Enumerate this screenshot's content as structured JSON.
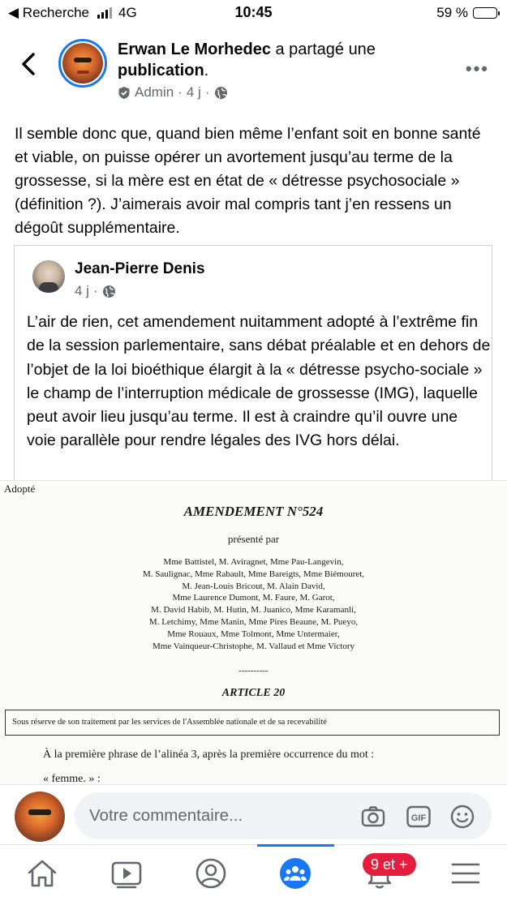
{
  "status_bar": {
    "back_app": "◀ Recherche",
    "network": "4G",
    "time": "10:45",
    "battery": "59 %",
    "battery_level": 0.59
  },
  "header": {
    "author_name": "Erwan Le Morhedec",
    "action_text": " a partagé une ",
    "action_link": "publication",
    "action_end": ".",
    "role": "Admin",
    "time": "4 j"
  },
  "post": {
    "text": "Il semble donc que, quand bien même l’enfant soit en bonne santé et viable, on puisse opérer un avortement jusqu’au terme de la grossesse, si la mère est en état de « détresse psychosociale » (définition ?). J’aimerais avoir mal compris tant j’en ressens un dégoût supplémentaire."
  },
  "shared": {
    "author": "Jean-Pierre Denis",
    "time": "4 j",
    "text": "L’air de rien, cet amendement nuitamment adopté à l’extrême fin de la session parlementaire, sans débat préalable et en dehors de l’objet de la loi bioéthique élargit à la « détresse psycho-sociale » le champ de l’interruption médicale de grossesse (IMG), laquelle peut avoir lieu jusqu’au terme. Il est à craindre qu’il ouvre une voie parallèle pour rendre légales des IVG hors délai."
  },
  "document": {
    "status": "Adopté",
    "title": "AMENDEMENT N°524",
    "presented_by": "présenté par",
    "authors": [
      "Mme Battistel, M. Aviragnet, Mme Pau-Langevin,",
      "M. Saulignac, Mme Rabault, Mme Bareigts, Mme Biémouret,",
      "M. Jean-Louis Bricout, M. Alain David,",
      "Mme Laurence Dumont, M. Faure, M. Garot,",
      "M. David Habib, M. Hutin, M. Juanico, Mme Karamanli,",
      "M. Letchimy, Mme Manin, Mme Pires Beaune, M. Pueyo,",
      "Mme Rouaux, Mme Tolmont, Mme Untermaier,",
      "Mme Vainqueur-Christophe, M. Vallaud et Mme Victory"
    ],
    "separator": "----------",
    "article": "ARTICLE 20",
    "reserve": "Sous réserve de son traitement par les services de l'Assemblée nationale et de sa recevabilité",
    "paragraph": "À la première phrase de l’alinéa 3, après la première occurrence du mot :",
    "quote": "« femme. » :"
  },
  "comment": {
    "placeholder": "Votre commentaire..."
  },
  "nav": {
    "badge": "9 et +"
  },
  "colors": {
    "accent": "#1877f2",
    "badge": "#e41e3f",
    "secondary_text": "#65676b"
  }
}
